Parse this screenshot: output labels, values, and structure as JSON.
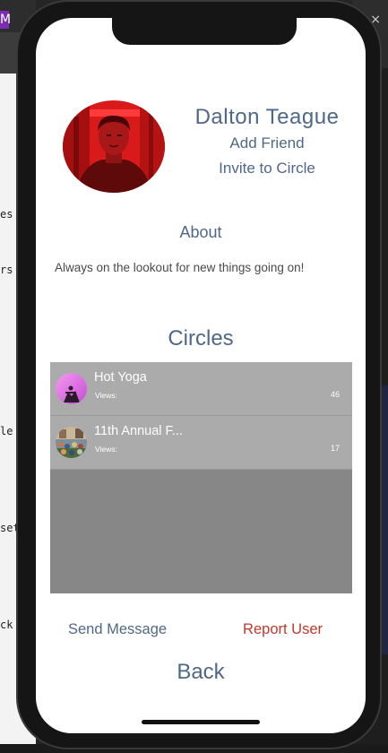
{
  "colors": {
    "accent_text": "#4f6887",
    "danger_text": "#c0392b",
    "list_row_bg": "#ababab",
    "list_bg": "#878787"
  },
  "background_editor": {
    "left_fragments": [
      "es",
      "rs",
      "le",
      "set",
      "ck"
    ],
    "close_glyph": "×",
    "logo_glyph": "M"
  },
  "profile": {
    "name": "Dalton Teague",
    "avatar_icon": "user-photo",
    "add_friend_label": "Add Friend",
    "invite_label": "Invite to Circle"
  },
  "about": {
    "heading": "About",
    "text": "Always on the lookout for new things going on!"
  },
  "circles": {
    "heading": "Circles",
    "items": [
      {
        "name": "Hot Yoga",
        "views_label": "Views:",
        "views": "46",
        "thumb_icon": "yoga-photo"
      },
      {
        "name": "11th Annual F...",
        "views_label": "Views:",
        "views": "17",
        "thumb_icon": "crowd-photo"
      }
    ]
  },
  "actions": {
    "send_message_label": "Send Message",
    "report_user_label": "Report User",
    "back_label": "Back"
  }
}
